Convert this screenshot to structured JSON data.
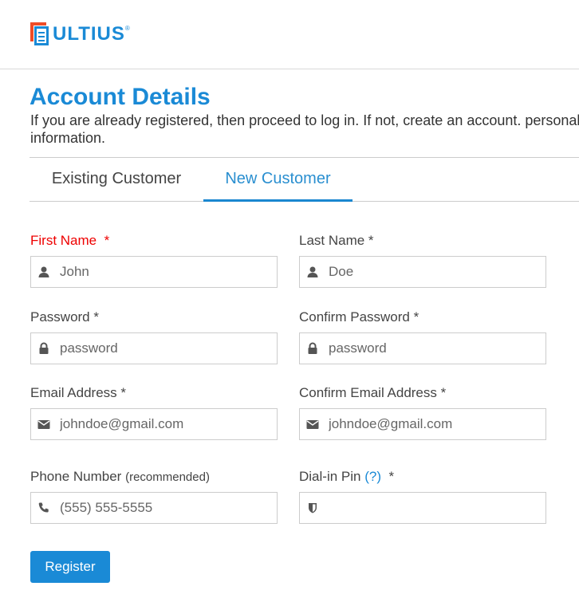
{
  "brand": {
    "name": "ULTIUS",
    "registered_mark": "®",
    "colors": {
      "primary": "#1a8ad6",
      "accent": "#ef4c27"
    }
  },
  "page": {
    "title": "Account Details",
    "intro": "If you are already registered, then proceed to log in. If not, create an account. personal information."
  },
  "tabs": [
    {
      "label": "Existing Customer",
      "active": false
    },
    {
      "label": "New Customer",
      "active": true
    }
  ],
  "form": {
    "first_name": {
      "label": "First Name",
      "required_mark": "*",
      "value": "John",
      "icon": "user-icon",
      "error": true
    },
    "last_name": {
      "label": "Last Name *",
      "value": "Doe",
      "icon": "user-icon"
    },
    "password": {
      "label": "Password *",
      "placeholder": "password",
      "icon": "lock-icon"
    },
    "confirm_password": {
      "label": "Confirm Password *",
      "placeholder": "password",
      "icon": "lock-icon"
    },
    "email": {
      "label": "Email Address *",
      "value": "johndoe@gmail.com",
      "icon": "envelope-icon"
    },
    "confirm_email": {
      "label": "Confirm Email Address *",
      "value": "johndoe@gmail.com",
      "icon": "envelope-icon"
    },
    "phone": {
      "label": "Phone Number",
      "label_note": "(recommended)",
      "placeholder": "(555) 555-5555",
      "icon": "phone-icon"
    },
    "dial_in_pin": {
      "label": "Dial-in Pin",
      "help": "(?)",
      "required_mark": "*",
      "value": "",
      "icon": "shield-icon"
    },
    "submit_label": "Register"
  }
}
